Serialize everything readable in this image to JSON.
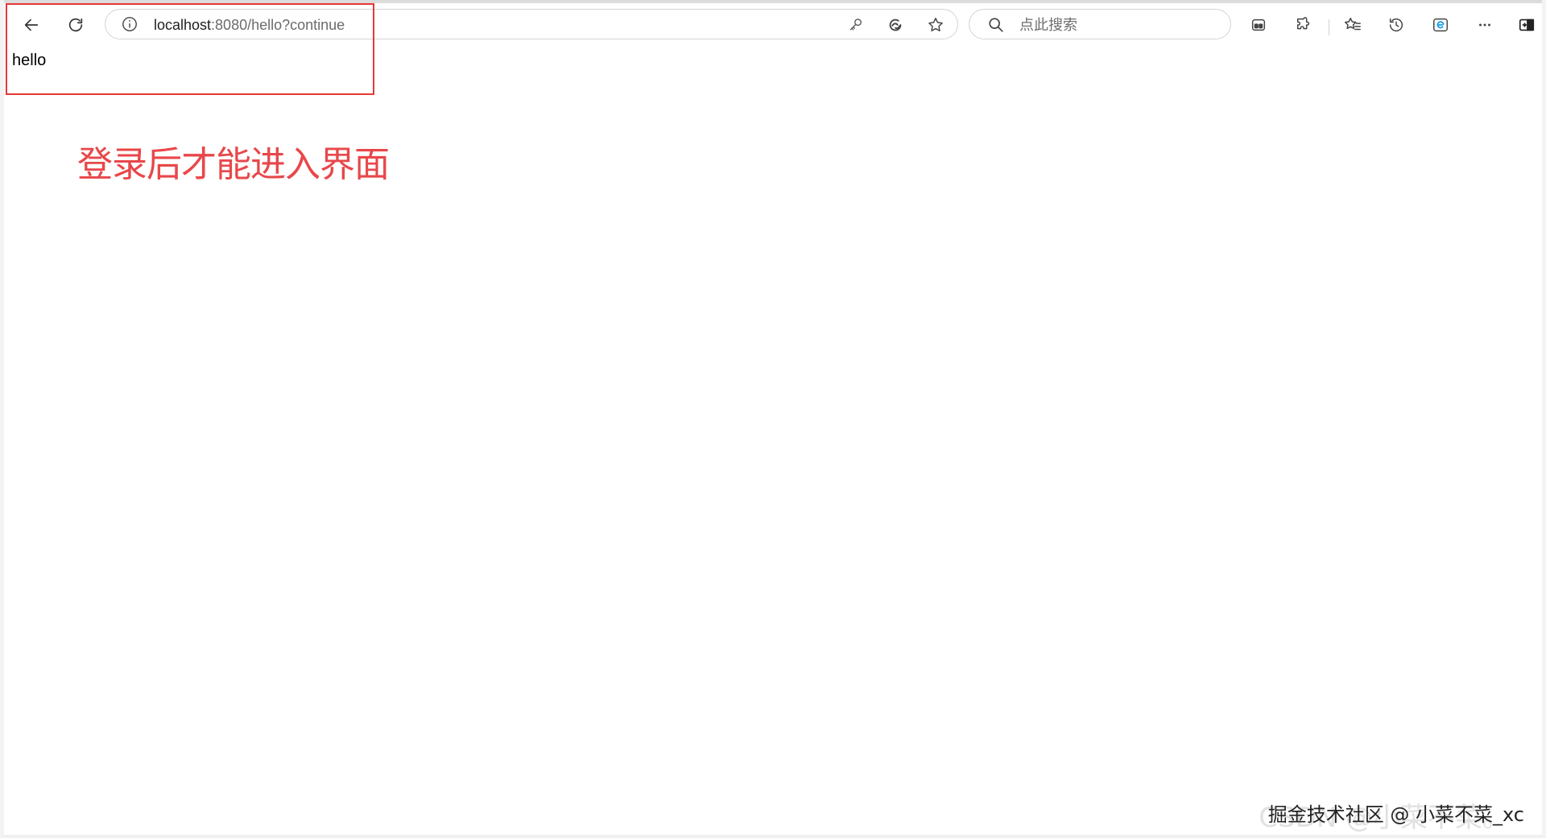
{
  "browser": {
    "address": {
      "host": "localhost",
      "rest": ":8080/hello?continue"
    },
    "search": {
      "placeholder": "点此搜索"
    }
  },
  "icons": [
    "back-arrow-icon",
    "refresh-icon",
    "site-info-icon",
    "key-icon",
    "edge-refresh-icon",
    "favorite-star-icon",
    "search-icon",
    "workspaces-icon",
    "extensions-icon",
    "favorites-icon",
    "history-icon",
    "edge-bar-icon",
    "more-icon",
    "sidebar-toggle-icon"
  ],
  "page": {
    "text": "hello"
  },
  "annotation": {
    "text": "登录后才能进入界面"
  },
  "watermark": {
    "text": "掘金技术社区 @ 小菜不菜_xc",
    "ghost": "CSDN @小菜不菜。"
  },
  "colors": {
    "annotation": "#e8474a",
    "highlight": "#e53935"
  }
}
